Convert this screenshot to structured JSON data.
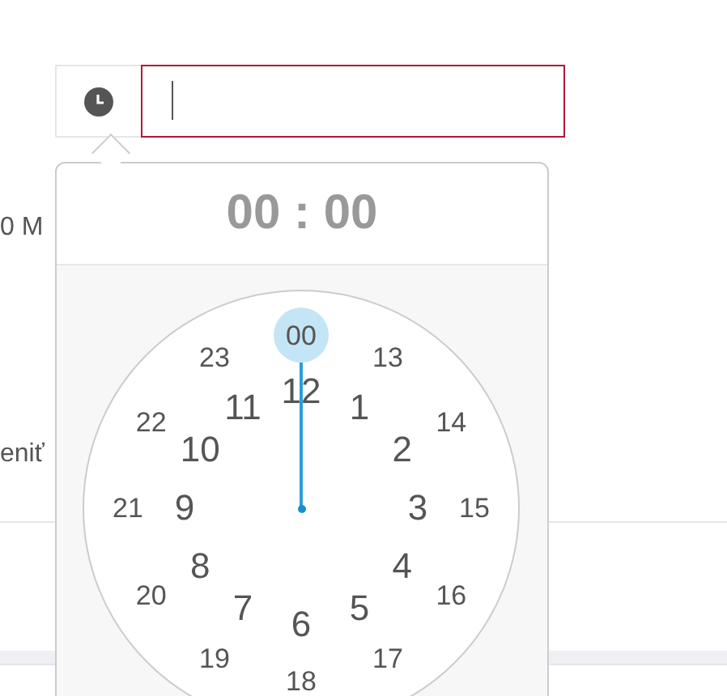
{
  "background_texts": [
    "0 M",
    "eniť"
  ],
  "picker": {
    "header": "00 : 00",
    "outer_hours": [
      {
        "label": "00",
        "selected": true
      },
      {
        "label": "13",
        "selected": false
      },
      {
        "label": "14",
        "selected": false
      },
      {
        "label": "15",
        "selected": false
      },
      {
        "label": "16",
        "selected": false
      },
      {
        "label": "17",
        "selected": false
      },
      {
        "label": "18",
        "selected": false
      },
      {
        "label": "19",
        "selected": false
      },
      {
        "label": "20",
        "selected": false
      },
      {
        "label": "21",
        "selected": false
      },
      {
        "label": "22",
        "selected": false
      },
      {
        "label": "23",
        "selected": false
      }
    ],
    "inner_hours": [
      {
        "label": "10",
        "selected": false
      },
      {
        "label": "11",
        "selected": false
      },
      {
        "label": "12",
        "selected": false
      },
      {
        "label": "1",
        "selected": false
      },
      {
        "label": "2",
        "selected": false
      },
      {
        "label": "3",
        "selected": false
      },
      {
        "label": "4",
        "selected": false
      },
      {
        "label": "5",
        "selected": false
      },
      {
        "label": "6",
        "selected": false
      },
      {
        "label": "7",
        "selected": false
      },
      {
        "label": "8",
        "selected": false
      },
      {
        "label": "9",
        "selected": false
      }
    ]
  }
}
